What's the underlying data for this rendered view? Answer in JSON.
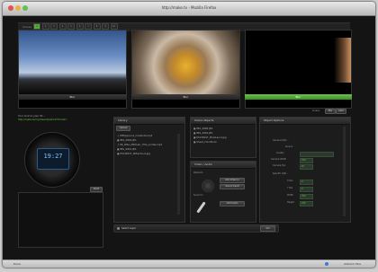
{
  "window": {
    "title": "http://make.tv - Mozilla Firefox"
  },
  "top": {
    "label": "Scenes",
    "cells": [
      "1",
      "2",
      "3",
      "4",
      "5",
      "6",
      "7",
      "8",
      "9",
      "10"
    ]
  },
  "screens": [
    {
      "button": "Blur"
    },
    {
      "button": "Blur"
    },
    {
      "button": "Blur"
    }
  ],
  "mode": {
    "label": "Screen",
    "options": [
      "Mix",
      "Cam"
    ]
  },
  "left": {
    "intro": "Your Link to your St...",
    "link": "http://make.tv/mystream/patrick?format=",
    "clock": "19:27",
    "notes_button": "Send"
  },
  "library": {
    "title": "Library",
    "tab": "Upload",
    "items": [
      "STB/pipocos_mosfunta.mp3",
      "IMG_0949.JPG",
      "PR_IMke_2008.eb-_Title_Lurdes.mp3",
      "IMG_0941.JPG",
      "P1040637_Stfber2a.id.jpg"
    ],
    "add_button": "Upload Layer"
  },
  "scene_objects": {
    "title": "Scene Objects",
    "items": [
      "IMG_0948.JPG",
      "IMG_0949.JPG",
      "P1030097_Sfow1as.id.jpg",
      "Sheet_Colorblock"
    ]
  },
  "video_audio": {
    "title": "Video / Audio",
    "webcam_label": "Webcam",
    "sound_label": "Sound In",
    "cam_button": "Add Video In",
    "sound_button": "Sound Input",
    "audio_button": "Add Audio"
  },
  "object_options": {
    "title": "Object Options",
    "general": "General Opti...",
    "source": "Source",
    "quality_label": "Quality",
    "camera_width_label": "Camera Width",
    "camera_width_value": "320",
    "camera_fps_label": "Camera Fps",
    "camera_fps_value": "15",
    "specific": "Specific Opti...",
    "xpos_label": "X Pos",
    "xpos_value": "0",
    "ypos_label": "Y Pos",
    "ypos_value": "0",
    "width_label": "Width",
    "width_value": "320",
    "height_label": "Height",
    "height_value": "240"
  },
  "bottom": {
    "select_label": "Select Layer",
    "go_button": "GO"
  },
  "status": {
    "left": "Done",
    "right": "Adblock Plus"
  },
  "colors": {
    "accent": "#5aa83c",
    "bg": "#141414",
    "panel": "#1c1c1c"
  }
}
